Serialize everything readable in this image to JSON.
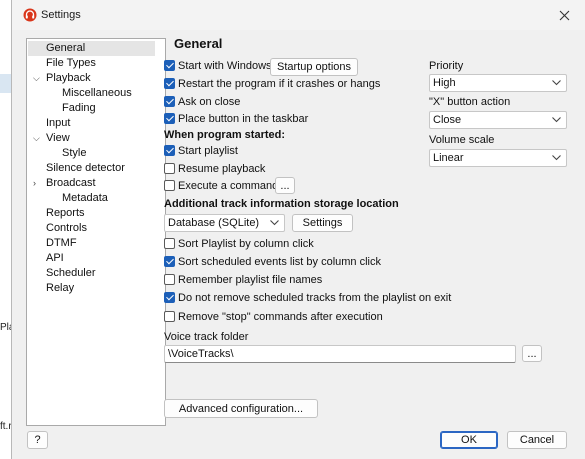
{
  "background": {
    "text_1": "Play",
    "text_2": "ft.r"
  },
  "window": {
    "title": "Settings"
  },
  "tree": [
    {
      "label": "General",
      "selected": true
    },
    {
      "label": "File Types"
    },
    {
      "label": "Playback",
      "expanded": true
    },
    {
      "label": "Miscellaneous"
    },
    {
      "label": "Fading"
    },
    {
      "label": "Input"
    },
    {
      "label": "View",
      "expanded": true
    },
    {
      "label": "Style"
    },
    {
      "label": "Silence detector"
    },
    {
      "label": "Broadcast",
      "expanded": false
    },
    {
      "label": "Metadata"
    },
    {
      "label": "Reports"
    },
    {
      "label": "Controls"
    },
    {
      "label": "DTMF"
    },
    {
      "label": "API"
    },
    {
      "label": "Scheduler"
    },
    {
      "label": "Relay"
    }
  ],
  "general": {
    "title": "General",
    "start_with_windows": "Start with Windows",
    "startup_options": "Startup options",
    "restart_on_crash": "Restart the program if it crashes or hangs",
    "ask_on_close": "Ask on close",
    "place_button_taskbar": "Place button in the taskbar",
    "when_started": "When program started:",
    "start_playlist": "Start playlist",
    "resume_playback": "Resume playback",
    "execute_command": "Execute a command",
    "ellipsis": "...",
    "storage_location": "Additional track information storage location",
    "storage_value": "Database (SQLite)",
    "settings_button": "Settings",
    "sort_playlist": "Sort Playlist by column click",
    "sort_scheduled": "Sort scheduled events list by column click",
    "remember_names": "Remember playlist file names",
    "no_remove_scheduled": "Do not remove scheduled tracks from the playlist on exit",
    "remove_stop": "Remove \"stop\" commands after execution",
    "voice_track_folder": "Voice track folder",
    "voice_track_value": "\\VoiceTracks\\",
    "advanced_config": "Advanced configuration..."
  },
  "priority": {
    "label": "Priority",
    "value": "High"
  },
  "x_button": {
    "label": "\"X\" button action",
    "value": "Close"
  },
  "volume": {
    "label": "Volume scale",
    "value": "Linear"
  },
  "footer": {
    "help": "?",
    "ok": "OK",
    "cancel": "Cancel"
  },
  "checks": {
    "start_with_windows": true,
    "restart_on_crash": true,
    "ask_on_close": true,
    "place_button_taskbar": true,
    "start_playlist": true,
    "resume_playback": false,
    "execute_command": false,
    "sort_playlist": false,
    "sort_scheduled": true,
    "remember_names": false,
    "no_remove_scheduled": true,
    "remove_stop": false
  },
  "colors": {
    "accent": "#1c5fb8",
    "app_icon": "#d9361b"
  },
  "icons": {
    "app": "headphones-icon",
    "close": "close-icon",
    "chevron": "chevron-down-icon",
    "tree_expand": "chevron-expand-icon"
  }
}
